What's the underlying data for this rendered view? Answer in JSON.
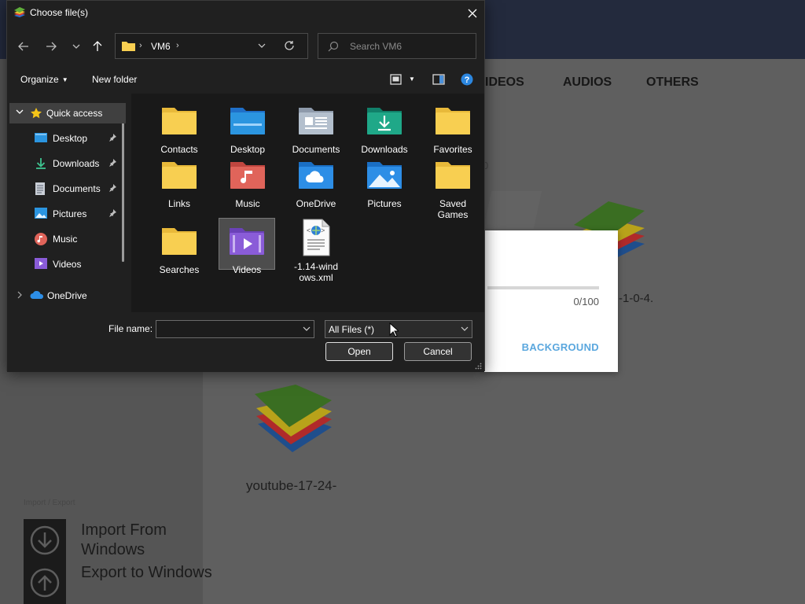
{
  "background_app": {
    "tabs": [
      "VIDEOS",
      "AUDIOS",
      "OTHERS"
    ],
    "tab_videos_partial": "IDEOS",
    "import_export_label": "Import / Export",
    "import_label": "Import From Windows",
    "export_label": "Export to Windows",
    "file_caption_1": "youtube-17-24-",
    "file_caption_2": "-1-0-4.",
    "faint_char": "0"
  },
  "progress_dialog": {
    "count": "0/100",
    "progress": 0,
    "background_button": "BACKGROUND"
  },
  "file_dialog": {
    "title": "Choose file(s)",
    "address": "VM6",
    "search_placeholder": "Search VM6",
    "toolbar": {
      "organize": "Organize",
      "new_folder": "New folder"
    },
    "nav_pane": {
      "quick_access": "Quick access",
      "items": [
        "Desktop",
        "Downloads",
        "Documents",
        "Pictures",
        "Music",
        "Videos"
      ],
      "onedrive": "OneDrive"
    },
    "files": [
      {
        "label": "Contacts",
        "icon": "folder-icon"
      },
      {
        "label": "Desktop",
        "icon": "desktop-folder-icon"
      },
      {
        "label": "Documents",
        "icon": "documents-folder-icon"
      },
      {
        "label": "Downloads",
        "icon": "downloads-folder-icon"
      },
      {
        "label": "Favorites",
        "icon": "folder-icon"
      },
      {
        "label": "Links",
        "icon": "folder-icon"
      },
      {
        "label": "Music",
        "icon": "music-folder-icon"
      },
      {
        "label": "OneDrive",
        "icon": "onedrive-folder-icon"
      },
      {
        "label": "Pictures",
        "icon": "pictures-folder-icon"
      },
      {
        "label": "Saved Games",
        "icon": "folder-icon"
      },
      {
        "label": "Searches",
        "icon": "folder-icon"
      },
      {
        "label": "Videos",
        "icon": "videos-folder-icon",
        "selected": true
      },
      {
        "label": "-1.14-windows.xml",
        "icon": "xml-file-icon",
        "display_lines": [
          "-1.14-wind",
          "ows.xml"
        ]
      }
    ],
    "file_name_label": "File name:",
    "file_name_value": "",
    "file_type": "All Files (*)",
    "open_button": "Open",
    "cancel_button": "Cancel"
  },
  "colors": {
    "dialog_bg": "#202020",
    "file_area_bg": "#191919",
    "folder_yellow": "#f8cf51",
    "accent_blue": "#5aa7de"
  }
}
